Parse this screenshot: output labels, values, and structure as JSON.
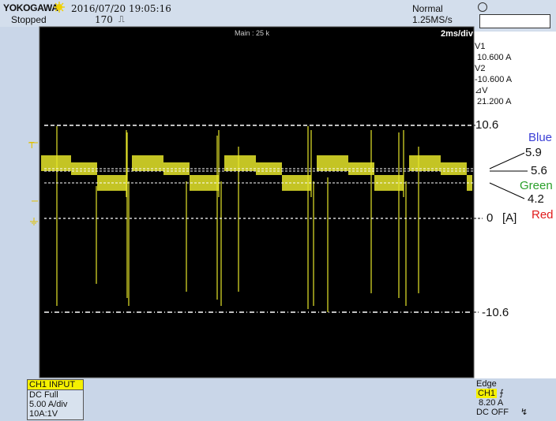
{
  "header": {
    "brand": "YOKOGAWA",
    "datetime": "2016/07/20 19:05:16",
    "status": "Stopped",
    "acq_count": "170",
    "trigger_mode": "Normal",
    "sample_rate": "1.25MS/s"
  },
  "screen": {
    "main_label": "Main : 25 k",
    "time_div": "2ms/div"
  },
  "cursors": {
    "v1_label": "V1",
    "v1_value": "10.600 A",
    "v2_label": "V2",
    "v2_value": "-10.600 A",
    "dv_label": "V",
    "dv_value": "21.200 A"
  },
  "annotations": {
    "top_line": "10.6",
    "blue_label": "Blue",
    "blue_value": "5.9",
    "mid_value": "5.6",
    "green_label": "Green",
    "green_value": "4.2",
    "zero_value": "0",
    "zero_unit": "[A]",
    "red_label": "Red",
    "bottom_line": "-10.6"
  },
  "channel": {
    "title": "CH1 INPUT",
    "coupling": "DC Full",
    "vdiv": "5.00 A/div",
    "probe": "10A:1V"
  },
  "trigger": {
    "type": "Edge",
    "source": "CH1",
    "level": "8.20 A",
    "coupling": "DC OFF"
  },
  "colors": {
    "trace": "#e6e62a",
    "blue": "#3b3fd6",
    "green": "#2aa02a",
    "red": "#e01a1a",
    "dashed": "#ffffff",
    "screen_bg": "#000000"
  }
}
